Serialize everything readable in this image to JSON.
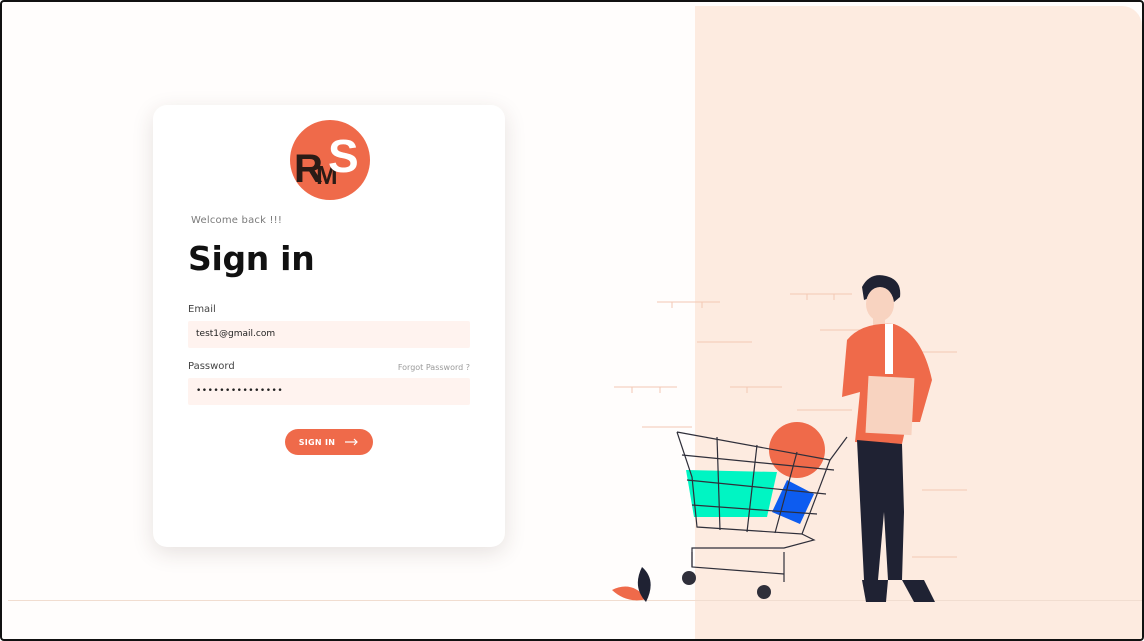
{
  "brand": {
    "logo_alt": "RMS logo",
    "logo_letters": "RMS"
  },
  "signin": {
    "welcome": "Welcome back !!!",
    "title": "Sign in",
    "email_label": "Email",
    "email_value": "test1@gmail.com",
    "password_label": "Password",
    "password_value": "•••••••••••••••",
    "forgot_label": "Forgot Password ?",
    "button_label": "SIGN IN"
  },
  "colors": {
    "accent": "#ef6a4a",
    "panel": "#fdebe0",
    "input_bg": "#fff3ef",
    "illustration_green": "#00f5c3",
    "illustration_blue": "#0d5cf0",
    "illustration_dark": "#1f2233"
  },
  "icons": {
    "arrow": "arrow-right-icon",
    "logo": "rms-logo-icon"
  }
}
